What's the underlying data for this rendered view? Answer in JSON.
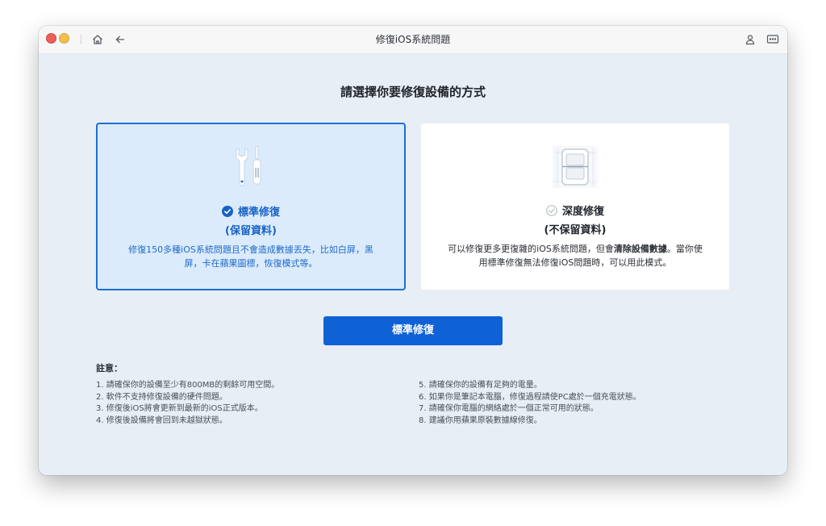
{
  "window": {
    "title": "修復iOS系統問題"
  },
  "icons": {
    "home": "home-icon",
    "back": "arrow-left-icon",
    "user": "user-icon",
    "feedback": "chat-icon"
  },
  "main": {
    "heading": "請選擇你要修復設備的方式"
  },
  "modes": [
    {
      "name": "標準修復",
      "subtitle": "(保留資料)",
      "selected": true,
      "description_line1": "修復150多種iOS系統問題且不會造成數據丟失，比如白屏，黑",
      "description_line2": "屏，卡在蘋果圖標，恢復模式等。"
    },
    {
      "name": "深度修復",
      "subtitle": "(不保留資料)",
      "selected": false,
      "description_line1_a": "可以修復更多更復雜的iOS系統問題，但會",
      "description_line1_bold": "清除設備數據",
      "description_line1_b": "。當你使",
      "description_line2": "用標準修復無法修復iOS問題時，可以用此模式。"
    }
  ],
  "primary_button": {
    "label": "標準修復"
  },
  "notes": {
    "title": "註意：",
    "left": [
      "1. 請確保你的設備至少有800MB的剩餘可用空間。",
      "2. 軟件不支持修復設備的硬件問題。",
      "3. 修復後iOS將會更新到最新的iOS正式版本。",
      "4. 修復後設備將會回到未越獄狀態。"
    ],
    "right": [
      "5. 請確保你的設備有足夠的電量。",
      "6. 如果你是筆記本電腦，修復過程請使PC處於一個充電狀態。",
      "7. 請確保你電腦的網絡處於一個正常可用的狀態。",
      "8. 建議你用蘋果原裝數據線修復。"
    ]
  },
  "colors": {
    "accent": "#0f62d6",
    "selected_bg": "#dcebfb",
    "window_bg": "#e8eef6"
  }
}
